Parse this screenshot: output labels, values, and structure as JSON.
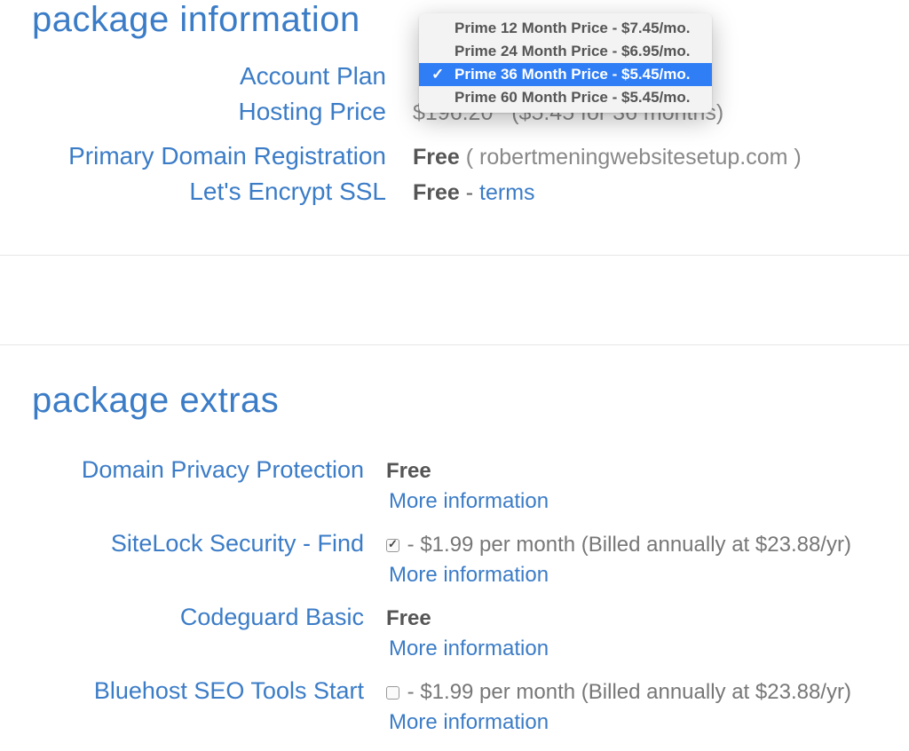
{
  "packageInfo": {
    "title": "package information",
    "accountPlan": {
      "label": "Account Plan",
      "dropdown": {
        "items": [
          "Prime 12 Month Price - $7.45/mo.",
          "Prime 24 Month Price - $6.95/mo.",
          "Prime 36 Month Price - $5.45/mo.",
          "Prime 60 Month Price - $5.45/mo."
        ],
        "selectedIndex": 2
      }
    },
    "hostingPrice": {
      "label": "Hosting Price",
      "amount": "$196.20",
      "detail": "($5.45 for 36 months)"
    },
    "primaryDomain": {
      "label": "Primary Domain Registration",
      "prefix": "Free",
      "domain": "( robertmeningwebsitesetup.com )"
    },
    "ssl": {
      "label": "Let's Encrypt SSL",
      "prefix": "Free",
      "dash": " - ",
      "linkText": "terms"
    }
  },
  "packageExtras": {
    "title": "package extras",
    "items": [
      {
        "label": "Domain Privacy Protection",
        "free": true,
        "freeText": "Free",
        "checked": false,
        "priceText": "",
        "moreInfo": "More information"
      },
      {
        "label": "SiteLock Security - Find",
        "free": false,
        "freeText": "",
        "checked": true,
        "priceText": " - $1.99 per month (Billed annually at $23.88/yr)",
        "moreInfo": "More information"
      },
      {
        "label": "Codeguard Basic",
        "free": true,
        "freeText": "Free",
        "checked": false,
        "priceText": "",
        "moreInfo": "More information"
      },
      {
        "label": "Bluehost SEO Tools Start",
        "free": false,
        "freeText": "",
        "checked": false,
        "priceText": " - $1.99 per month (Billed annually at $23.88/yr)",
        "moreInfo": "More information"
      }
    ]
  }
}
